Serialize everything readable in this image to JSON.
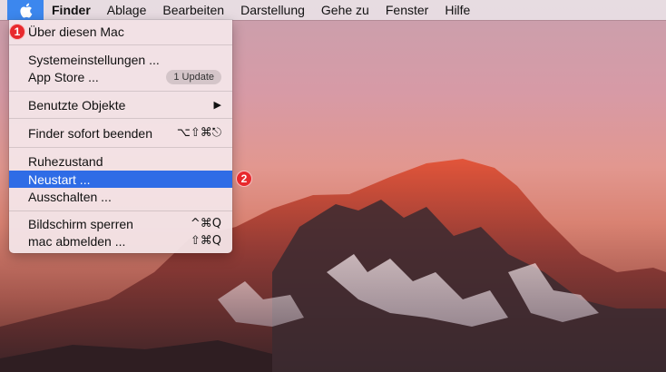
{
  "menubar": {
    "items": [
      "Finder",
      "Ablage",
      "Bearbeiten",
      "Darstellung",
      "Gehe zu",
      "Fenster",
      "Hilfe"
    ]
  },
  "apple_menu": {
    "about": "Über diesen Mac",
    "system_prefs": "Systemeinstellungen ...",
    "app_store": "App Store ...",
    "update_badge": "1 Update",
    "recent_items": "Benutzte Objekte",
    "force_quit": "Finder sofort beenden",
    "force_quit_shortcut": "⌥⇧⌘⎋",
    "sleep": "Ruhezustand",
    "restart": "Neustart ...",
    "shutdown": "Ausschalten ...",
    "lock_screen": "Bildschirm sperren",
    "lock_screen_shortcut": "^⌘Q",
    "log_out": "mac abmelden ...",
    "log_out_shortcut": "⇧⌘Q"
  },
  "annotations": {
    "marker1": "1",
    "marker2": "2"
  },
  "colors": {
    "selection": "#2f6ce6",
    "apple_button": "#3c87ee",
    "marker": "#e8292d"
  },
  "icons": {
    "apple": "apple-icon",
    "submenu": "chevron-right-icon"
  }
}
